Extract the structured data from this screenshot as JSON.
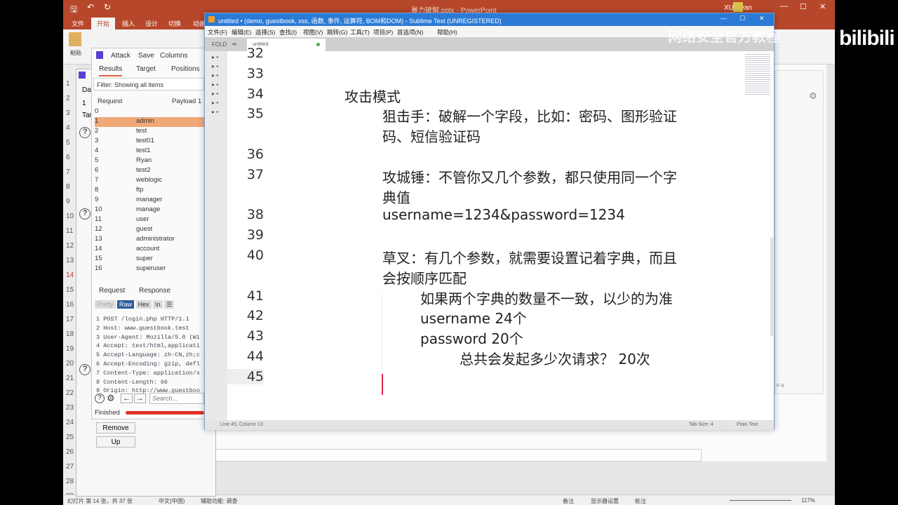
{
  "powerpoint": {
    "title": "暴力破解.pptx - PowerPoint",
    "user": "XU Ryan",
    "tabs": [
      "文件",
      "开始",
      "插入",
      "设计",
      "切换",
      "动画"
    ],
    "paste_label": "粘贴",
    "slide_numbers": [
      "1",
      "2",
      "3",
      "4",
      "5",
      "6",
      "7",
      "8",
      "9",
      "10",
      "11",
      "12",
      "13",
      "14",
      "15",
      "16",
      "17",
      "18",
      "19",
      "20",
      "21",
      "22",
      "23",
      "24",
      "25",
      "26",
      "27",
      "28",
      "29"
    ],
    "status": {
      "slide": "幻灯片 第 14 张，共 37 张",
      "language": "中文(中国)",
      "accessibility": "辅助功能: 调查",
      "notes": "备注",
      "display": "显示器设置",
      "comments": "批注",
      "zoom": "117%"
    }
  },
  "burp": {
    "menu": [
      "Attack",
      "Save",
      "Columns"
    ],
    "tabs": [
      "Results",
      "Target",
      "Positions"
    ],
    "filter": "Filter: Showing all items",
    "columns": [
      "Request",
      "Payload 1"
    ],
    "rows": [
      [
        "0",
        ""
      ],
      [
        "1",
        "admin"
      ],
      [
        "2",
        "test"
      ],
      [
        "3",
        "test01"
      ],
      [
        "4",
        "test1"
      ],
      [
        "5",
        "Ryan"
      ],
      [
        "6",
        "test2"
      ],
      [
        "7",
        "weblogic"
      ],
      [
        "8",
        "ftp"
      ],
      [
        "9",
        "manager"
      ],
      [
        "10",
        "manage"
      ],
      [
        "11",
        "user"
      ],
      [
        "12",
        "guest"
      ],
      [
        "13",
        "administrator"
      ],
      [
        "14",
        "account"
      ],
      [
        "15",
        "super"
      ],
      [
        "16",
        "superuser"
      ]
    ],
    "detail_tabs": [
      "Request",
      "Response"
    ],
    "view_buttons": [
      "Pretty",
      "Raw",
      "Hex",
      "\\n",
      "☰"
    ],
    "request_lines": [
      "1 POST /login.php HTTP/1.1",
      "2 Host: www.guestbook.test",
      "3 User-Agent: Mozilla/5.0 (Wi",
      "4 Accept: text/html,applicati",
      "5 Accept-Language: zh-CN,zh;c",
      "6 Accept-Encoding: gzip, defl",
      "7 Content-Type: application/x",
      "8 Content-Length: 66",
      "9 Origin: http://www.guestboo"
    ],
    "search_placeholder": "Search...",
    "status": "Finished",
    "back_labels": [
      "Da",
      "1",
      "Tar"
    ],
    "remove_label": "Remove",
    "up_label": "Up",
    "host": "www.guestbook.test"
  },
  "sublime": {
    "title": "untitled • (demo, guestbook, xss, 函数, 事件, 运算符, BOM和DOM) - Sublime Text (UNREGISTERED)",
    "menu": [
      "文件(F)",
      "编辑(E)",
      "选择(S)",
      "查找(I)",
      "视图(V)",
      "跳转(G)",
      "工具(T)",
      "项目(P)",
      "首选项(N)",
      "帮助(H)"
    ],
    "sidebar_label": "FOLD",
    "tab": "untitled",
    "lines": [
      {
        "n": "32",
        "t": ""
      },
      {
        "n": "33",
        "t": ""
      },
      {
        "n": "34",
        "t": "攻击模式"
      },
      {
        "n": "35",
        "t": "狙击手：破解一个字段，比如：密码、图形验证"
      },
      {
        "n": "",
        "t": "码、短信验证码"
      },
      {
        "n": "36",
        "t": ""
      },
      {
        "n": "37",
        "t": "攻城锤：不管你又几个参数，都只使用同一个字"
      },
      {
        "n": "",
        "t": "典值"
      },
      {
        "n": "38",
        "t": "username=1234&password=1234"
      },
      {
        "n": "39",
        "t": ""
      },
      {
        "n": "40",
        "t": "草叉：有几个参数，就需要设置记着字典，而且"
      },
      {
        "n": "",
        "t": "会按顺序匹配"
      },
      {
        "n": "41",
        "t": "如果两个字典的数量不一致，以少的为准"
      },
      {
        "n": "42",
        "t": "username  24个"
      },
      {
        "n": "43",
        "t": "password  20个"
      },
      {
        "n": "44",
        "t": "总共会发起多少次请求？ 20次"
      },
      {
        "n": "45",
        "t": ""
      }
    ],
    "status_left": "Line 45, Column 13",
    "tab_size": "Tab Size: 4",
    "syntax": "Plain Text",
    "encoding": "F-8"
  },
  "overlay": {
    "watermark": "网络安全官方教程",
    "logo": "bilibili"
  },
  "colors": {
    "ppt_red": "#b7472a",
    "sublime_blue": "#2b7bd6",
    "burp_select": "#f0a878",
    "burp_raw": "#2c5d9a"
  }
}
